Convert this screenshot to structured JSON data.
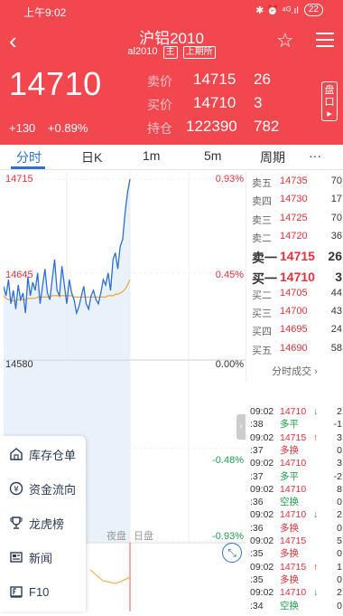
{
  "status_bar": {
    "time": "上午9:02",
    "icons_text": "✱ ⏰ ⁴ᴳ.ıl",
    "battery": "22"
  },
  "header": {
    "title": "沪铝2010",
    "code": "al2010",
    "tag_main": "主",
    "exchange": "上期所",
    "price": "14710",
    "change": "+130",
    "change_pct": "+0.89%",
    "sell_label": "卖价",
    "sell_price": "14715",
    "sell_qty": "26",
    "buy_label": "买价",
    "buy_price": "14710",
    "buy_qty": "3",
    "oi_label": "持仓",
    "oi_value": "122390",
    "oi_change": "782",
    "pankou_label": "盘口"
  },
  "tabs": [
    "分时",
    "日K",
    "1m",
    "5m",
    "周期",
    "···"
  ],
  "chart_data": {
    "type": "line",
    "y_labels": [
      {
        "price": "14715",
        "pct": "0.93%",
        "color": "red"
      },
      {
        "price": "14645",
        "pct": "0.45%",
        "color": "red"
      },
      {
        "price": "14580",
        "pct": "0.00%",
        "color": "black"
      },
      {
        "price": "",
        "pct": "-0.48%",
        "color": "green"
      },
      {
        "price": "",
        "pct": "-0.93%",
        "color": "green"
      }
    ],
    "ylim": [
      14445,
      14715
    ],
    "price_series": [
      14635,
      14628,
      14640,
      14622,
      14632,
      14618,
      14636,
      14625,
      14630,
      14615,
      14642,
      14628,
      14638,
      14632,
      14645,
      14622,
      14635,
      14648,
      14630,
      14625,
      14640,
      14655,
      14632,
      14628,
      14650,
      14636,
      14622,
      14640,
      14630,
      14625,
      14615,
      14620,
      14628,
      14635,
      14622,
      14618,
      14628,
      14632,
      14625,
      14622,
      14630,
      14640,
      14636,
      14645,
      14632,
      14655,
      14660,
      14648,
      14665,
      14670,
      14690,
      14705,
      14715
    ],
    "avg_series": [
      14628,
      14626,
      14625,
      14625,
      14624,
      14624,
      14625,
      14625,
      14625,
      14625,
      14626,
      14626,
      14626,
      14626,
      14627,
      14627,
      14627,
      14627,
      14627,
      14627,
      14628,
      14628,
      14628,
      14628,
      14628,
      14628,
      14628,
      14628,
      14628,
      14627,
      14627,
      14627,
      14627,
      14627,
      14627,
      14627,
      14627,
      14627,
      14627,
      14627,
      14627,
      14627,
      14627,
      14628,
      14628,
      14628,
      14629,
      14629,
      14630,
      14631,
      14633,
      14636,
      14640
    ],
    "night_label": "夜盘",
    "day_label": "日盘"
  },
  "order_book": [
    {
      "label": "卖五",
      "price": "14735",
      "qty": "70"
    },
    {
      "label": "卖四",
      "price": "14730",
      "qty": "17"
    },
    {
      "label": "卖三",
      "price": "14725",
      "qty": "70"
    },
    {
      "label": "卖二",
      "price": "14720",
      "qty": "36"
    },
    {
      "label": "卖一",
      "price": "14715",
      "qty": "26"
    },
    {
      "label": "买一",
      "price": "14710",
      "qty": "3"
    },
    {
      "label": "买二",
      "price": "14705",
      "qty": "44"
    },
    {
      "label": "买三",
      "price": "14700",
      "qty": "43"
    },
    {
      "label": "买四",
      "price": "14695",
      "qty": "24"
    },
    {
      "label": "买五",
      "price": "14690",
      "qty": "58"
    }
  ],
  "trades_header": "分时成交 ›",
  "trades": [
    {
      "time": "09:02",
      "val": "14710",
      "arrow": "↓",
      "qty": "2",
      "vcolor": "red",
      "acolor": "green"
    },
    {
      "time": ":38",
      "val": "多平",
      "arrow": "",
      "qty": "-1",
      "vcolor": "green",
      "acolor": ""
    },
    {
      "time": "09:02",
      "val": "14715",
      "arrow": "↑",
      "qty": "3",
      "vcolor": "red",
      "acolor": "red"
    },
    {
      "time": ":37",
      "val": "多换",
      "arrow": "",
      "qty": "0",
      "vcolor": "red",
      "acolor": ""
    },
    {
      "time": "09:02",
      "val": "14710",
      "arrow": "",
      "qty": "3",
      "vcolor": "red",
      "acolor": ""
    },
    {
      "time": ":37",
      "val": "多平",
      "arrow": "",
      "qty": "-2",
      "vcolor": "green",
      "acolor": ""
    },
    {
      "time": "09:02",
      "val": "14710",
      "arrow": "",
      "qty": "8",
      "vcolor": "red",
      "acolor": ""
    },
    {
      "time": ":36",
      "val": "空换",
      "arrow": "",
      "qty": "0",
      "vcolor": "green",
      "acolor": ""
    },
    {
      "time": "09:02",
      "val": "14710",
      "arrow": "↓",
      "qty": "2",
      "vcolor": "red",
      "acolor": "green"
    },
    {
      "time": ":36",
      "val": "多换",
      "arrow": "",
      "qty": "0",
      "vcolor": "red",
      "acolor": ""
    },
    {
      "time": "09:02",
      "val": "14715",
      "arrow": "",
      "qty": "5",
      "vcolor": "red",
      "acolor": ""
    },
    {
      "time": ":35",
      "val": "多换",
      "arrow": "",
      "qty": "0",
      "vcolor": "red",
      "acolor": ""
    },
    {
      "time": "09:02",
      "val": "14715",
      "arrow": "↑",
      "qty": "1",
      "vcolor": "red",
      "acolor": "red"
    },
    {
      "time": ":35",
      "val": "多换",
      "arrow": "",
      "qty": "0",
      "vcolor": "red",
      "acolor": ""
    },
    {
      "time": "09:02",
      "val": "14710",
      "arrow": "↓",
      "qty": "2",
      "vcolor": "red",
      "acolor": "green"
    },
    {
      "time": ":34",
      "val": "空换",
      "arrow": "",
      "qty": "0",
      "vcolor": "green",
      "acolor": ""
    }
  ],
  "left_menu": [
    {
      "icon": "warehouse-icon",
      "label": "库存仓单"
    },
    {
      "icon": "yuan-icon",
      "label": "资金流向"
    },
    {
      "icon": "trophy-icon",
      "label": "龙虎榜"
    },
    {
      "icon": "news-icon",
      "label": "新闻"
    },
    {
      "icon": "f10-icon",
      "label": "F10"
    }
  ],
  "colors": {
    "header_bg": "#f2474f",
    "up": "#e8303a",
    "down": "#1e9e4a",
    "accent": "#2d6fd6"
  }
}
